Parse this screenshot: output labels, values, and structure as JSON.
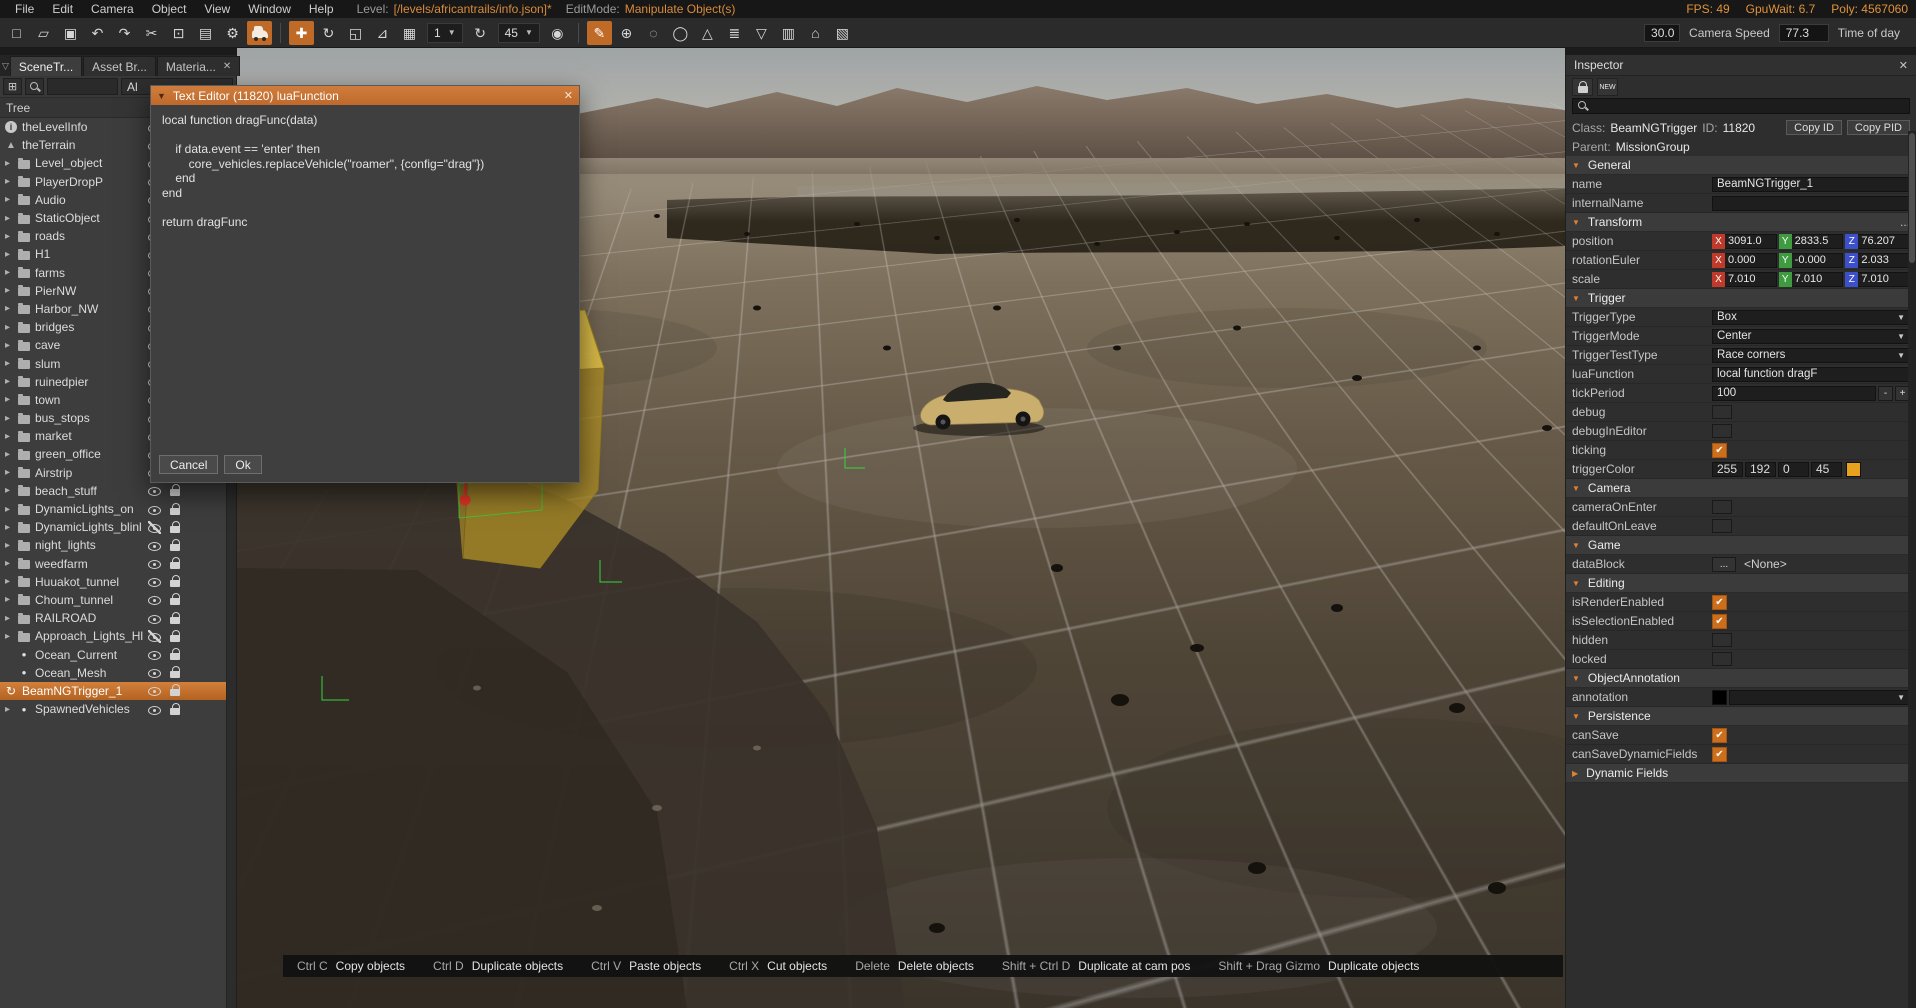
{
  "menubar": {
    "items": [
      "File",
      "Edit",
      "Camera",
      "Object",
      "View",
      "Window",
      "Help"
    ],
    "level_label": "Level:",
    "level_value": "[/levels/africantrails/info.json]*",
    "editmode_label": "EditMode:",
    "editmode_value": "Manipulate Object(s)",
    "stats": [
      "FPS: 49",
      "GpuWait: 6.7",
      "Poly: 4567060"
    ]
  },
  "toolbar": {
    "icons": [
      {
        "glyph": "□",
        "name": "new-file-icon"
      },
      {
        "glyph": "▱",
        "name": "open-folder-icon"
      },
      {
        "glyph": "▣",
        "name": "save-icon"
      },
      {
        "glyph": "↶",
        "name": "undo-icon"
      },
      {
        "glyph": "↷",
        "name": "redo-icon"
      },
      {
        "glyph": "✂",
        "name": "cut-icon"
      },
      {
        "glyph": "⊡",
        "name": "copy-icon"
      },
      {
        "glyph": "▤",
        "name": "paste-icon"
      },
      {
        "glyph": "⚙",
        "name": "settings-icon"
      },
      {
        "type": "car",
        "name": "vehicle-tool-icon",
        "active": true
      },
      {
        "type": "sep"
      },
      {
        "glyph": "✚",
        "name": "translate-tool-icon",
        "active": true
      },
      {
        "glyph": "↻",
        "name": "rotate-tool-icon"
      },
      {
        "glyph": "◱",
        "name": "scale-tool-icon"
      },
      {
        "glyph": "⊿",
        "name": "ruler-icon"
      },
      {
        "glyph": "▦",
        "name": "snap-grid-icon"
      },
      {
        "type": "dd",
        "value": "1",
        "name": "snap-size-dropdown"
      },
      {
        "glyph": "↻",
        "name": "rotate-snap-icon"
      },
      {
        "type": "dd",
        "value": "45",
        "name": "rotate-snap-dropdown"
      },
      {
        "glyph": "◉",
        "name": "magnet-icon"
      },
      {
        "type": "sep"
      },
      {
        "glyph": "✎",
        "name": "draw-tool-icon",
        "active": true
      },
      {
        "glyph": "⊕",
        "name": "add-object-icon"
      },
      {
        "glyph": "◌",
        "name": "lasso-icon"
      },
      {
        "glyph": "◯",
        "name": "ellipse-icon"
      },
      {
        "glyph": "△",
        "name": "terrain-icon"
      },
      {
        "glyph": "≣",
        "name": "layers-icon"
      },
      {
        "glyph": "▽",
        "name": "water-icon"
      },
      {
        "glyph": "▥",
        "name": "bricks-icon"
      },
      {
        "glyph": "⌂",
        "name": "building-icon"
      },
      {
        "glyph": "▧",
        "name": "decal-icon"
      }
    ],
    "camera_speed_small_value": "30.0",
    "camera_speed_label": "Camera Speed",
    "camera_speed_value": "77.3",
    "time_of_day_label": "Time of day"
  },
  "left_panel": {
    "lead_icon": "▽",
    "tabs": [
      {
        "label": "SceneTr...",
        "active": true,
        "close": false
      },
      {
        "label": "Asset Br...",
        "active": false,
        "close": false
      },
      {
        "label": "Materia...",
        "active": false,
        "close": true
      }
    ],
    "add_button_glyph": "⊞",
    "filter_value": "Al",
    "tree_label": "Tree",
    "tree": [
      {
        "label": "theLevelInfo",
        "icon": "info"
      },
      {
        "label": "theTerrain",
        "icon": "terrain"
      },
      {
        "label": "Level_object",
        "icon": "folder",
        "chevron": true
      },
      {
        "label": "PlayerDropP",
        "icon": "folder",
        "chevron": true
      },
      {
        "label": "Audio",
        "icon": "folder",
        "chevron": true
      },
      {
        "label": "StaticObject",
        "icon": "folder",
        "chevron": true
      },
      {
        "label": "roads",
        "icon": "folder",
        "chevron": true
      },
      {
        "label": "H1",
        "icon": "folder",
        "chevron": true
      },
      {
        "label": "farms",
        "icon": "folder",
        "chevron": true
      },
      {
        "label": "PierNW",
        "icon": "folder",
        "chevron": true
      },
      {
        "label": "Harbor_NW",
        "icon": "folder",
        "chevron": true
      },
      {
        "label": "bridges",
        "icon": "folder",
        "chevron": true
      },
      {
        "label": "cave",
        "icon": "folder",
        "chev ron": false,
        "chevron": true
      },
      {
        "label": "slum",
        "icon": "folder",
        "chevron": true
      },
      {
        "label": "ruinedpier",
        "icon": "folder",
        "chevron": true
      },
      {
        "label": "town",
        "icon": "folder",
        "chevron": true
      },
      {
        "label": "bus_stops",
        "icon": "folder",
        "chevron": true
      },
      {
        "label": "market",
        "icon": "folder",
        "chevron": true
      },
      {
        "label": "green_office",
        "icon": "folder",
        "chevron": true
      },
      {
        "label": "Airstrip",
        "icon": "folder",
        "chevron": true
      },
      {
        "label": "beach_stuff",
        "icon": "folder",
        "chevron": true
      },
      {
        "label": "DynamicLights_on",
        "icon": "folder",
        "chevron": true
      },
      {
        "label": "DynamicLights_blinl",
        "icon": "folder",
        "chevron": true,
        "eyeOff": true
      },
      {
        "label": "night_lights",
        "icon": "folder",
        "chevron": true
      },
      {
        "label": "weedfarm",
        "icon": "folder",
        "chevron": true
      },
      {
        "label": "Huuakot_tunnel",
        "icon": "folder",
        "chevron": true
      },
      {
        "label": "Choum_tunnel",
        "icon": "folder",
        "chevron": true
      },
      {
        "label": "RAILROAD",
        "icon": "folder",
        "chevron": true
      },
      {
        "label": "Approach_Lights_Hl",
        "icon": "folder",
        "chevron": true,
        "eyeOff": true
      },
      {
        "label": "Ocean_Current",
        "icon": "circle",
        "indent": true
      },
      {
        "label": "Ocean_Mesh",
        "icon": "circle",
        "indent": true
      },
      {
        "label": "BeamNGTrigger_1",
        "icon": "trigger",
        "selected": true
      },
      {
        "label": "SpawnedVehicles",
        "icon": "circle",
        "chevron": true
      }
    ]
  },
  "dialog": {
    "title": "Text Editor (11820) luaFunction",
    "code_lines": [
      "local function dragFunc(data)",
      "",
      "    if data.event == 'enter' then",
      "        core_vehicles.replaceVehicle(\"roamer\", {config=\"drag\"})",
      "    end",
      "end",
      "",
      "return dragFunc"
    ],
    "cancel_label": "Cancel",
    "ok_label": "Ok"
  },
  "inspector": {
    "title": "Inspector",
    "new_label": "NEW",
    "class_label": "Class:",
    "class_value": "BeamNGTrigger",
    "id_label": "ID:",
    "id_value": "11820",
    "copy_id_label": "Copy ID",
    "copy_pid_label": "Copy PID",
    "parent_label": "Parent:",
    "parent_value": "MissionGroup",
    "sections": [
      {
        "title": "General",
        "rows": [
          {
            "label": "name",
            "type": "input",
            "value": "BeamNGTrigger_1"
          },
          {
            "label": "internalName",
            "type": "input",
            "value": ""
          }
        ]
      },
      {
        "title": "Transform",
        "more": "...",
        "rows": [
          {
            "label": "position",
            "type": "xyz",
            "x": "3091.0",
            "y": "2833.5",
            "z": "76.207"
          },
          {
            "label": "rotationEuler",
            "type": "xyz",
            "x": "0.000",
            "y": "-0.000",
            "z": "2.033"
          },
          {
            "label": "scale",
            "type": "xyz",
            "x": "7.010",
            "y": "7.010",
            "z": "7.010"
          }
        ]
      },
      {
        "title": "Trigger",
        "rows": [
          {
            "label": "TriggerType",
            "type": "dropdown",
            "value": "Box"
          },
          {
            "label": "TriggerMode",
            "type": "dropdown",
            "value": "Center"
          },
          {
            "label": "TriggerTestType",
            "type": "dropdown",
            "value": "Race corners"
          },
          {
            "label": "luaFunction",
            "type": "input",
            "value": "local function dragF"
          },
          {
            "label": "tickPeriod",
            "type": "stepper",
            "value": "100",
            "minus": "-",
            "plus": "+"
          },
          {
            "label": "debug",
            "type": "check",
            "checked": false
          },
          {
            "label": "debugInEditor",
            "type": "check",
            "checked": false
          },
          {
            "label": "ticking",
            "type": "check",
            "checked": true
          },
          {
            "label": "triggerColor",
            "type": "color4",
            "values": [
              "255",
              "192",
              "0",
              "45"
            ],
            "swatch": "#e8a11f"
          }
        ]
      },
      {
        "title": "Camera",
        "rows": [
          {
            "label": "cameraOnEnter",
            "type": "check",
            "checked": false
          },
          {
            "label": "defaultOnLeave",
            "type": "check",
            "checked": false
          }
        ]
      },
      {
        "title": "Game",
        "rows": [
          {
            "label": "dataBlock",
            "type": "datablock",
            "button": "...",
            "value": "<None>"
          }
        ]
      },
      {
        "title": "Editing",
        "rows": [
          {
            "label": "isRenderEnabled",
            "type": "check",
            "checked": true
          },
          {
            "label": "isSelectionEnabled",
            "type": "check",
            "checked": true
          },
          {
            "label": "hidden",
            "type": "check",
            "checked": false
          },
          {
            "label": "locked",
            "type": "check",
            "checked": false
          }
        ]
      },
      {
        "title": "ObjectAnnotation",
        "rows": [
          {
            "label": "annotation",
            "type": "annotation",
            "swatch": "#000000"
          }
        ]
      },
      {
        "title": "Persistence",
        "rows": [
          {
            "label": "canSave",
            "type": "check",
            "checked": true
          },
          {
            "label": "canSaveDynamicFields",
            "type": "check",
            "checked": true
          }
        ]
      },
      {
        "title": "Dynamic Fields",
        "collapsed": true,
        "rows": []
      }
    ]
  },
  "statusbar": {
    "shortcuts": [
      {
        "keys": "Ctrl C",
        "desc": "Copy objects"
      },
      {
        "keys": "Ctrl D",
        "desc": "Duplicate objects"
      },
      {
        "keys": "Ctrl V",
        "desc": "Paste objects"
      },
      {
        "keys": "Ctrl X",
        "desc": "Cut objects"
      },
      {
        "keys": "Delete",
        "desc": "Delete objects"
      },
      {
        "keys": "Shift + Ctrl D",
        "desc": "Duplicate at cam pos"
      },
      {
        "keys": "Shift + Drag Gizmo",
        "desc": "Duplicate objects"
      }
    ]
  },
  "colors": {
    "accent": "#c06a28",
    "selection": "#c8742c",
    "checkbox": "#cd6e1d",
    "trigger_yellow": "#c8a832",
    "axis_x": "#bf3a2b",
    "axis_y": "#3f9b3f",
    "axis_z": "#3c50cc"
  }
}
